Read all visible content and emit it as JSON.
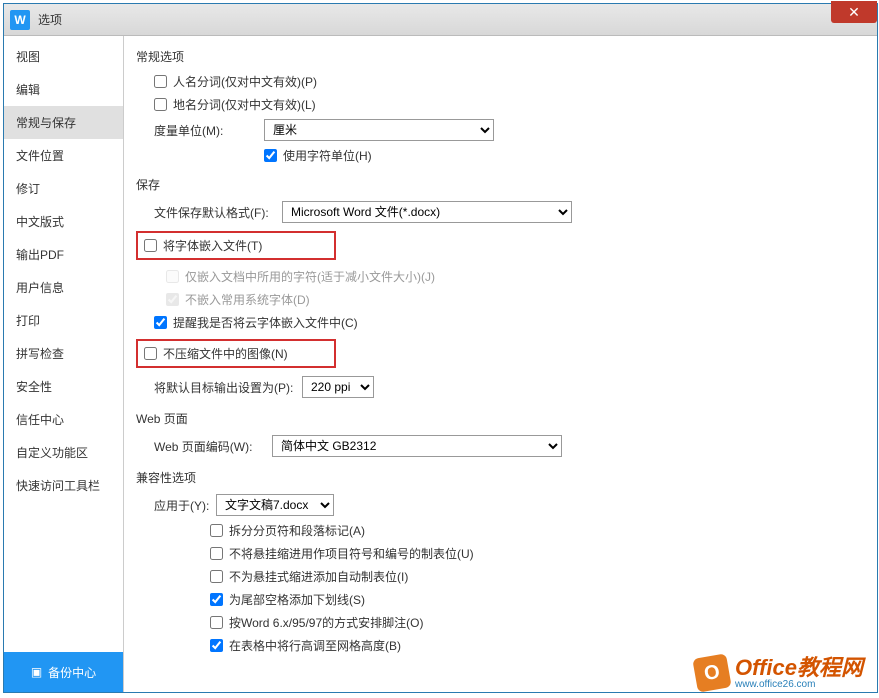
{
  "window": {
    "title": "选项",
    "logo_char": "W"
  },
  "sidebar": {
    "items": [
      {
        "label": "视图"
      },
      {
        "label": "编辑"
      },
      {
        "label": "常规与保存"
      },
      {
        "label": "文件位置"
      },
      {
        "label": "修订"
      },
      {
        "label": "中文版式"
      },
      {
        "label": "输出PDF"
      },
      {
        "label": "用户信息"
      },
      {
        "label": "打印"
      },
      {
        "label": "拼写检查"
      },
      {
        "label": "安全性"
      },
      {
        "label": "信任中心"
      },
      {
        "label": "自定义功能区"
      },
      {
        "label": "快速访问工具栏"
      }
    ],
    "backup_label": "备份中心"
  },
  "general": {
    "title": "常规选项",
    "person_name_split": "人名分词(仅对中文有效)(P)",
    "place_name_split": "地名分词(仅对中文有效)(L)",
    "unit_label": "度量单位(M):",
    "unit_value": "厘米",
    "use_char_unit": "使用字符单位(H)"
  },
  "save": {
    "title": "保存",
    "default_format_label": "文件保存默认格式(F):",
    "default_format_value": "Microsoft Word 文件(*.docx)",
    "embed_fonts": "将字体嵌入文件(T)",
    "embed_only_used": "仅嵌入文档中所用的字符(适于减小文件大小)(J)",
    "no_embed_system": "不嵌入常用系统字体(D)",
    "remind_cloud": "提醒我是否将云字体嵌入文件中(C)",
    "no_compress_img": "不压缩文件中的图像(N)",
    "default_target_label": "将默认目标输出设置为(P):",
    "default_target_value": "220 ppi"
  },
  "web": {
    "title": "Web 页面",
    "encoding_label": "Web 页面编码(W):",
    "encoding_value": "简体中文 GB2312"
  },
  "compat": {
    "title": "兼容性选项",
    "apply_to_label": "应用于(Y):",
    "apply_to_value": "文字文稿7.docx",
    "split_page": "拆分分页符和段落标记(A)",
    "no_hang_indent": "不将悬挂缩进用作项目符号和编号的制表位(U)",
    "no_auto_tab": "不为悬挂式缩进添加自动制表位(I)",
    "tail_underline": "为尾部空格添加下划线(S)",
    "word6_endnote": "按Word 6.x/95/97的方式安排脚注(O)",
    "table_height": "在表格中将行高调至网格高度(B)"
  },
  "watermark": {
    "text": "Office教程网",
    "url": "www.office26.com"
  }
}
